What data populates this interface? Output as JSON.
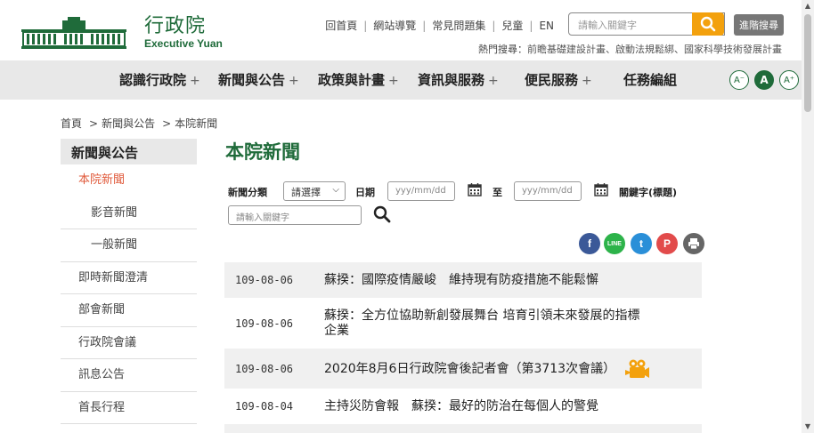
{
  "header": {
    "logo_zh": "行政院",
    "logo_en": "Executive Yuan",
    "top_links": [
      "回首頁",
      "網站導覽",
      "常見問題集",
      "兒童",
      "EN"
    ],
    "search_placeholder": "請輸入關鍵字",
    "advanced_search": "進階搜尋",
    "hot_label": "熱門搜尋：",
    "hot_terms": "前瞻基礎建設計畫、啟動法規鬆綁、國家科學技術發展計畫"
  },
  "nav": {
    "items": [
      "認識行政院",
      "新聞與公告",
      "政策與計畫",
      "資訊與服務",
      "便民服務",
      "任務編組"
    ],
    "plus": "+",
    "font_small": "A⁻",
    "font_normal": "A",
    "font_large": "A⁺"
  },
  "breadcrumb": {
    "home": "首頁",
    "level1": "新聞與公告",
    "level2": "本院新聞",
    "sep": ">"
  },
  "sidebar": {
    "heading": "新聞與公告",
    "items": [
      "本院新聞",
      "影音新聞",
      "一般新聞",
      "即時新聞澄清",
      "部會新聞",
      "行政院會議",
      "訊息公告",
      "首長行程"
    ]
  },
  "content": {
    "title": "本院新聞",
    "filter": {
      "category_label": "新聞分類",
      "category_value": "請選擇",
      "date_label": "日期",
      "date_from_placeholder": "yyy/mm/dd",
      "to_label": "至",
      "date_to_placeholder": "yyy/mm/dd",
      "keyword_label": "關鍵字(標題)",
      "keyword_placeholder": "請輸入關鍵字"
    },
    "share": {
      "facebook": "f",
      "line": "LINE",
      "twitter": "t",
      "plurk": "P"
    },
    "news": [
      {
        "date": "109-08-06",
        "title": "蘇揆：國際疫情嚴峻　維持現有防疫措施不能鬆懈"
      },
      {
        "date": "109-08-06",
        "title_line1": "蘇揆：全方位協助新創發展舞台 培育引領未來發展的指標",
        "title_line2": "企業"
      },
      {
        "date": "109-08-06",
        "title": "2020年8月6日行政院會後記者會（第3713次會議）"
      },
      {
        "date": "109-08-04",
        "title": "主持災防會報　蘇揆：最好的防治在每個人的警覺"
      }
    ]
  },
  "colors": {
    "brand_green": "#1f6b3a",
    "accent_orange": "#f3a10d",
    "active_red": "#e05a3b",
    "nav_bg": "#e8e8e8"
  }
}
